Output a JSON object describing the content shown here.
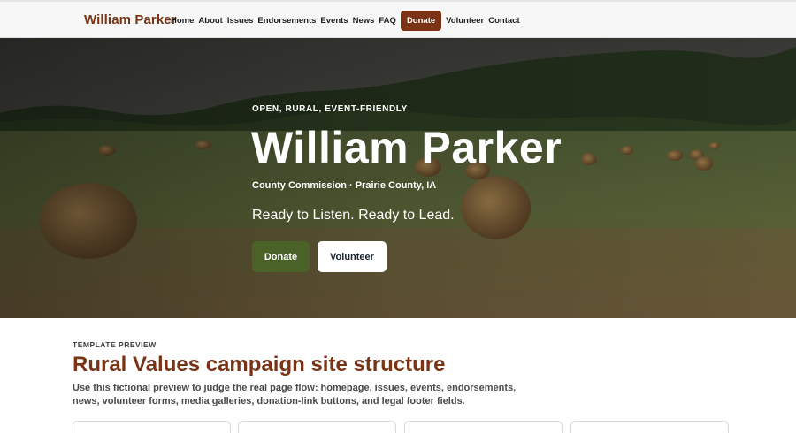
{
  "nav": {
    "brand": "William Parker",
    "items": [
      "Home",
      "About",
      "Issues",
      "Endorsements",
      "Events",
      "News",
      "FAQ",
      "Donate",
      "Volunteer",
      "Contact"
    ]
  },
  "hero": {
    "eyebrow": "OPEN, RURAL, EVENT-FRIENDLY",
    "title": "William Parker",
    "subtitle": "County Commission · Prairie County, IA",
    "tagline": "Ready to Listen. Ready to Lead.",
    "donate_label": "Donate",
    "volunteer_label": "Volunteer"
  },
  "preview": {
    "label": "TEMPLATE PREVIEW",
    "title": "Rural Values campaign site structure",
    "description": "Use this fictional preview to judge the real page flow: homepage, issues, events, endorsements, news, volunteer forms, media galleries, donation-link buttons, and legal footer fields."
  },
  "colors": {
    "brand": "#7a3415",
    "donate_button": "#4a6128",
    "nav_background": "#f7f7f7"
  }
}
